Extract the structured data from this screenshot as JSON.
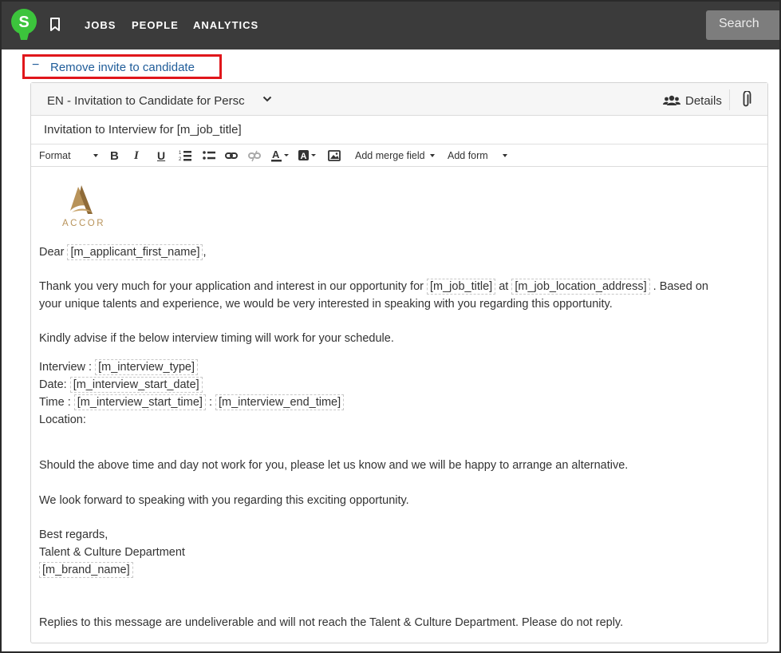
{
  "nav": {
    "logo_letter": "S",
    "items": [
      {
        "label": "JOBS"
      },
      {
        "label": "PEOPLE"
      },
      {
        "label": "ANALYTICS"
      }
    ],
    "search_placeholder": "Search"
  },
  "invite": {
    "toggle_symbol": "−",
    "remove_label": "Remove invite to candidate"
  },
  "editor": {
    "template_name": "EN - Invitation to Candidate for Persc",
    "details_label": "Details",
    "subject": "Invitation to Interview for [m_job_title]",
    "toolbar": {
      "format_label": "Format",
      "bold": "B",
      "italic": "I",
      "underline": "U",
      "merge_field_label": "Add merge field",
      "add_form_label": "Add form"
    },
    "brand_logo_text": "ACCOR",
    "body": {
      "greeting_prefix": "Dear",
      "greeting_field": "[m_applicant_first_name]",
      "greeting_suffix": ",",
      "p1_a": "Thank you very much for your application and interest in our opportunity for",
      "p1_field_job": "[m_job_title]",
      "p1_at": "at",
      "p1_field_location": "[m_job_location_address]",
      "p1_b": ". Based on",
      "p1_c": "your unique talents and experience, we would be very interested in speaking with you regarding this opportunity.",
      "p2": "Kindly advise if the below interview timing will work for your schedule.",
      "interview_label": "Interview :",
      "interview_field": "[m_interview_type]",
      "date_label": "Date:",
      "date_field": "[m_interview_start_date]",
      "time_label": "Time :",
      "time_start_field": "[m_interview_start_time]",
      "time_sep": ":",
      "time_end_field": "[m_interview_end_time]",
      "location_label": "Location:",
      "p3": "Should the above time and day not work for you, please let us know and we will be happy to arrange an alternative.",
      "p4": "We look forward to speaking with you regarding this exciting opportunity.",
      "regards": "Best regards,",
      "department": "Talent & Culture Department",
      "brand_field": "[m_brand_name]",
      "footer": "Replies to this message are undeliverable and will not reach the Talent & Culture Department. Please do not reply."
    }
  },
  "colors": {
    "topbar": "#3b3b3b",
    "logo_green": "#3cc43c",
    "link_blue": "#1f5c99",
    "highlight_red": "#e0161b",
    "accor_gold": "#b8935a"
  }
}
